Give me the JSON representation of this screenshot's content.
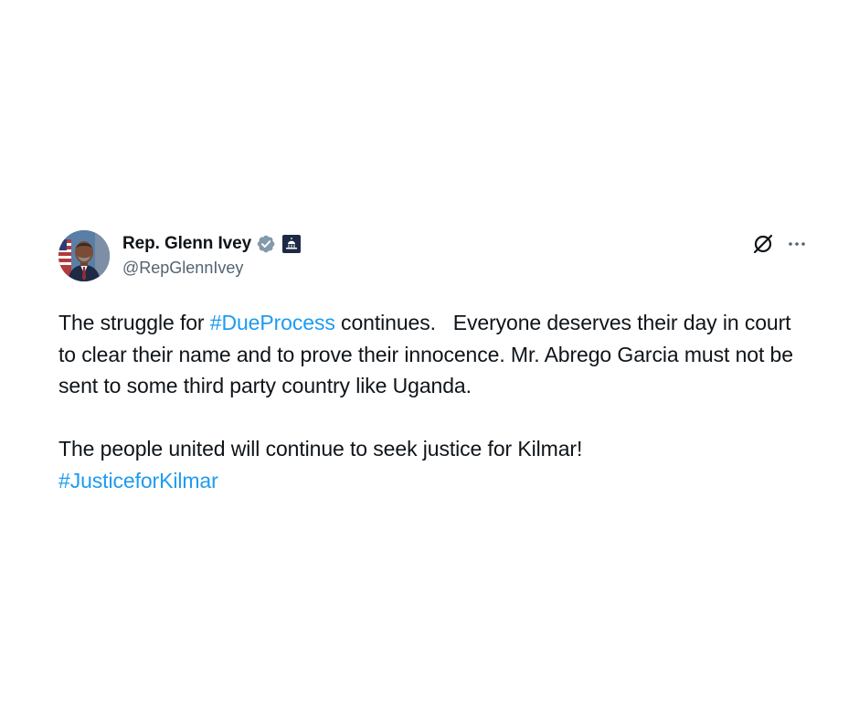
{
  "author": {
    "display_name": "Rep. Glenn Ivey",
    "handle": "@RepGlennIvey",
    "verified": true,
    "verified_color": "#829aab",
    "affiliation_badge": "capitol-building"
  },
  "actions": {
    "grok_icon": "grok-icon",
    "more_icon": "more-options-icon"
  },
  "post": {
    "p1_text_a": "The struggle for ",
    "p1_hashtag": "#DueProcess",
    "p1_text_b": " continues.   Everyone deserves their day in court to clear their name and to prove their innocence. Mr. Abrego Garcia must not be sent to some third party country like Uganda.",
    "p2_text": "The people united will continue to seek justice for Kilmar!",
    "p2_hashtag": "#JusticeforKilmar"
  },
  "colors": {
    "text": "#0f1419",
    "secondary_text": "#536471",
    "link": "#1d9bf0",
    "background": "#ffffff"
  }
}
